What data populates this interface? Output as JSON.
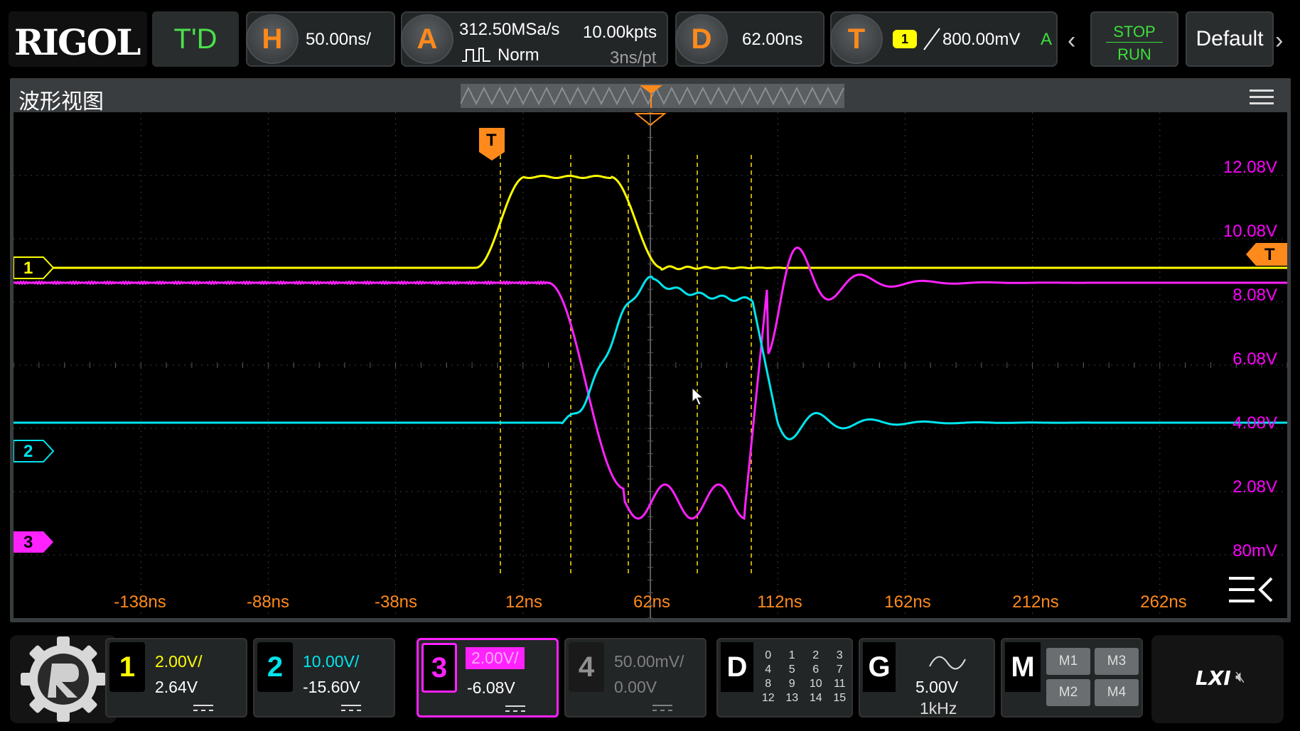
{
  "topbar": {
    "logo": "RIGOL",
    "mode": "T'D",
    "horizontal": {
      "key": "H",
      "scale": "50.00ns/"
    },
    "acquire": {
      "key": "A",
      "sample_rate": "312.50MSa/s",
      "memory_depth": "10.00kpts",
      "mode": "Norm",
      "resolution": "3ns/pt"
    },
    "delay": {
      "key": "D",
      "value": "62.00ns"
    },
    "trigger": {
      "key": "T",
      "source": "1",
      "level": "800.00mV",
      "mode": "A"
    },
    "stop_label": "STOP",
    "run_label": "RUN",
    "default_label": "Default"
  },
  "waveform": {
    "title": "波形视图",
    "channel_markers": [
      "1",
      "2",
      "3"
    ],
    "trigger_marker": "T",
    "level_marker": "T",
    "v_scale_labels": [
      "12.08V",
      "10.08V",
      "8.08V",
      "6.08V",
      "4.08V",
      "2.08V",
      "80mV"
    ],
    "time_labels": [
      "-138ns",
      "-88ns",
      "-38ns",
      "12ns",
      "62ns",
      "112ns",
      "162ns",
      "212ns",
      "262ns"
    ],
    "colors": {
      "ch1": "#ffff00",
      "ch2": "#00e5ee",
      "ch3": "#ff22ff",
      "ch4": "#808080",
      "cursor": "#ffe000",
      "trigger": "#ff8a1c"
    }
  },
  "channels": [
    {
      "num": "1",
      "scale": "2.00V/",
      "offset": "2.64V"
    },
    {
      "num": "2",
      "scale": "10.00V/",
      "offset": "-15.60V"
    },
    {
      "num": "3",
      "scale": "2.00V/",
      "offset": "-6.08V"
    },
    {
      "num": "4",
      "scale": "50.00mV/",
      "offset": "0.00V"
    }
  ],
  "digital": {
    "label": "D",
    "bits": [
      "0",
      "1",
      "2",
      "3",
      "4",
      "5",
      "6",
      "7",
      "8",
      "9",
      "10",
      "11",
      "12",
      "13",
      "14",
      "15"
    ]
  },
  "generator": {
    "label": "G",
    "amplitude": "5.00V",
    "frequency": "1kHz"
  },
  "math": {
    "label": "M",
    "buttons": [
      "M1",
      "M3",
      "M2",
      "M4"
    ]
  },
  "status": {
    "lxi": "LXI"
  }
}
